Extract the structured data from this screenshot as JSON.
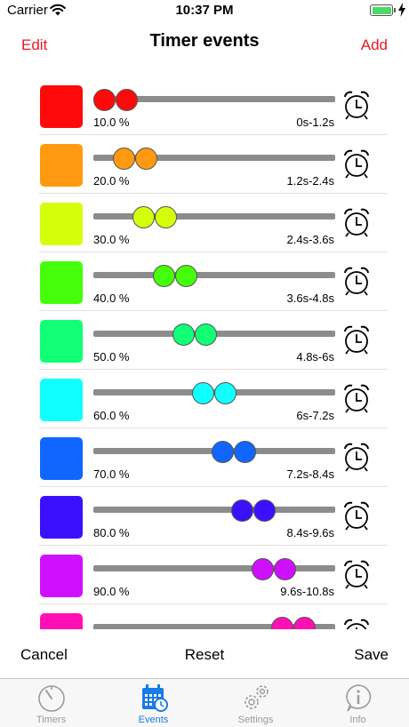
{
  "status_bar": {
    "carrier": "Carrier",
    "time": "10:37 PM"
  },
  "nav": {
    "left": "Edit",
    "title": "Timer events",
    "right": "Add"
  },
  "events": [
    {
      "color": "#ff0a0a",
      "percent": "10.0 %",
      "range": "0s-1.2s",
      "start": 0.0,
      "end": 0.1
    },
    {
      "color": "#ff9910",
      "percent": "20.0 %",
      "range": "1.2s-2.4s",
      "start": 0.1,
      "end": 0.2
    },
    {
      "color": "#d4ff0a",
      "percent": "30.0 %",
      "range": "2.4s-3.6s",
      "start": 0.2,
      "end": 0.3
    },
    {
      "color": "#45ff0a",
      "percent": "40.0 %",
      "range": "3.6s-4.8s",
      "start": 0.3,
      "end": 0.4
    },
    {
      "color": "#10ff75",
      "percent": "50.0 %",
      "range": "4.8s-6s",
      "start": 0.4,
      "end": 0.5
    },
    {
      "color": "#10ffff",
      "percent": "60.0 %",
      "range": "6s-7.2s",
      "start": 0.5,
      "end": 0.6
    },
    {
      "color": "#1066ff",
      "percent": "70.0 %",
      "range": "7.2s-8.4s",
      "start": 0.6,
      "end": 0.7
    },
    {
      "color": "#3a10ff",
      "percent": "80.0 %",
      "range": "8.4s-9.6s",
      "start": 0.7,
      "end": 0.8
    },
    {
      "color": "#cf10ff",
      "percent": "90.0 %",
      "range": "9.6s-10.8s",
      "start": 0.8,
      "end": 0.9
    },
    {
      "color": "#ff10b4",
      "percent": "",
      "range": "",
      "start": 0.9,
      "end": 1.0
    }
  ],
  "toolbar": {
    "cancel": "Cancel",
    "reset": "Reset",
    "save": "Save"
  },
  "tabs": [
    {
      "label": "Timers",
      "icon": "timer-icon",
      "active": false
    },
    {
      "label": "Events",
      "icon": "events-calendar-icon",
      "active": true
    },
    {
      "label": "Settings",
      "icon": "gears-icon",
      "active": false
    },
    {
      "label": "Info",
      "icon": "info-bubble-icon",
      "active": false
    }
  ],
  "colors": {
    "accent": "#e8191f",
    "tab_active": "#1a7ae6",
    "tab_inactive": "#9a9a9a"
  }
}
